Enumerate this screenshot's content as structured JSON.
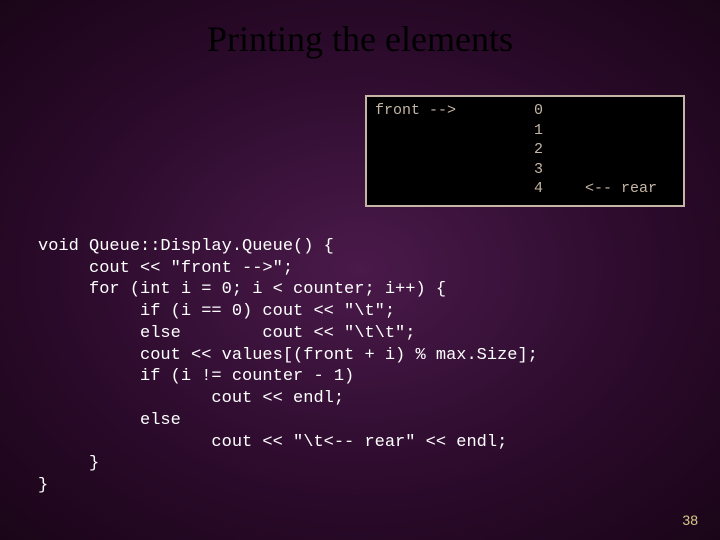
{
  "title": "Printing the elements",
  "output": {
    "front_label": "front -->",
    "rear_label": "<-- rear",
    "values": [
      "0",
      "1",
      "2",
      "3",
      "4"
    ]
  },
  "code": {
    "l1": "void Queue::Display.Queue() {",
    "l2": "     cout << \"front -->\";",
    "l3": "     for (int i = 0; i < counter; i++) {",
    "l4": "          if (i == 0) cout << \"\\t\";",
    "l5": "          else        cout << \"\\t\\t\";",
    "l6": "          cout << values[(front + i) % max.Size];",
    "l7": "          if (i != counter - 1)",
    "l8": "                 cout << endl;",
    "l9": "          else",
    "l10": "                 cout << \"\\t<-- rear\" << endl;",
    "l11": "     }",
    "l12": "}"
  },
  "page_number": "38"
}
